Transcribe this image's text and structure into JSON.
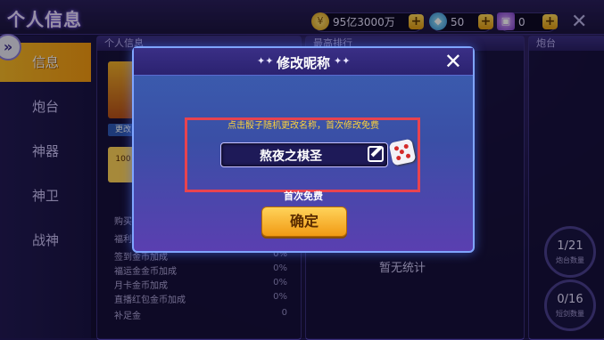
{
  "header": {
    "title": "个人信息",
    "gold": "95亿3000万",
    "diamond": "50",
    "ticket": "0"
  },
  "sidebar": {
    "items": [
      {
        "label": "信息"
      },
      {
        "label": "炮台"
      },
      {
        "label": "神器"
      },
      {
        "label": "神卫"
      },
      {
        "label": "战神"
      }
    ]
  },
  "panels": {
    "personal_info_title": "个人信息",
    "middle_title": "最高排行",
    "cannon_title": "炮台",
    "change_btn": "更改",
    "level_badge": "100",
    "empty_stats": "暂无统计",
    "stats": [
      {
        "label": "购买",
        "value": ""
      },
      {
        "label": "福利",
        "value": ""
      },
      {
        "label": "签到金币加成",
        "value": "0%"
      },
      {
        "label": "福运金金币加成",
        "value": "0%"
      },
      {
        "label": "月卡金币加成",
        "value": "0%"
      },
      {
        "label": "直播红包金币加成",
        "value": "0%"
      },
      {
        "label": "补足金",
        "value": "0"
      }
    ],
    "cannon_count": {
      "value": "1/21",
      "label": "炮台数量"
    },
    "short_count": {
      "value": "0/16",
      "label": "短剑数量"
    }
  },
  "dialog": {
    "title": "修改昵称",
    "hint": "点击骰子随机更改名称，首次修改免费",
    "name_value": "熬夜之棋圣",
    "first_free": "首次免费",
    "confirm": "确定"
  },
  "colors": {
    "accent_gold": "#f5a315",
    "highlight_red": "#e8434f",
    "dialog_border": "#7fa5ff"
  },
  "icons": [
    "coin-icon",
    "diamond-icon",
    "ticket-icon",
    "close-icon",
    "edit-icon",
    "dice-icon",
    "back-icon"
  ]
}
